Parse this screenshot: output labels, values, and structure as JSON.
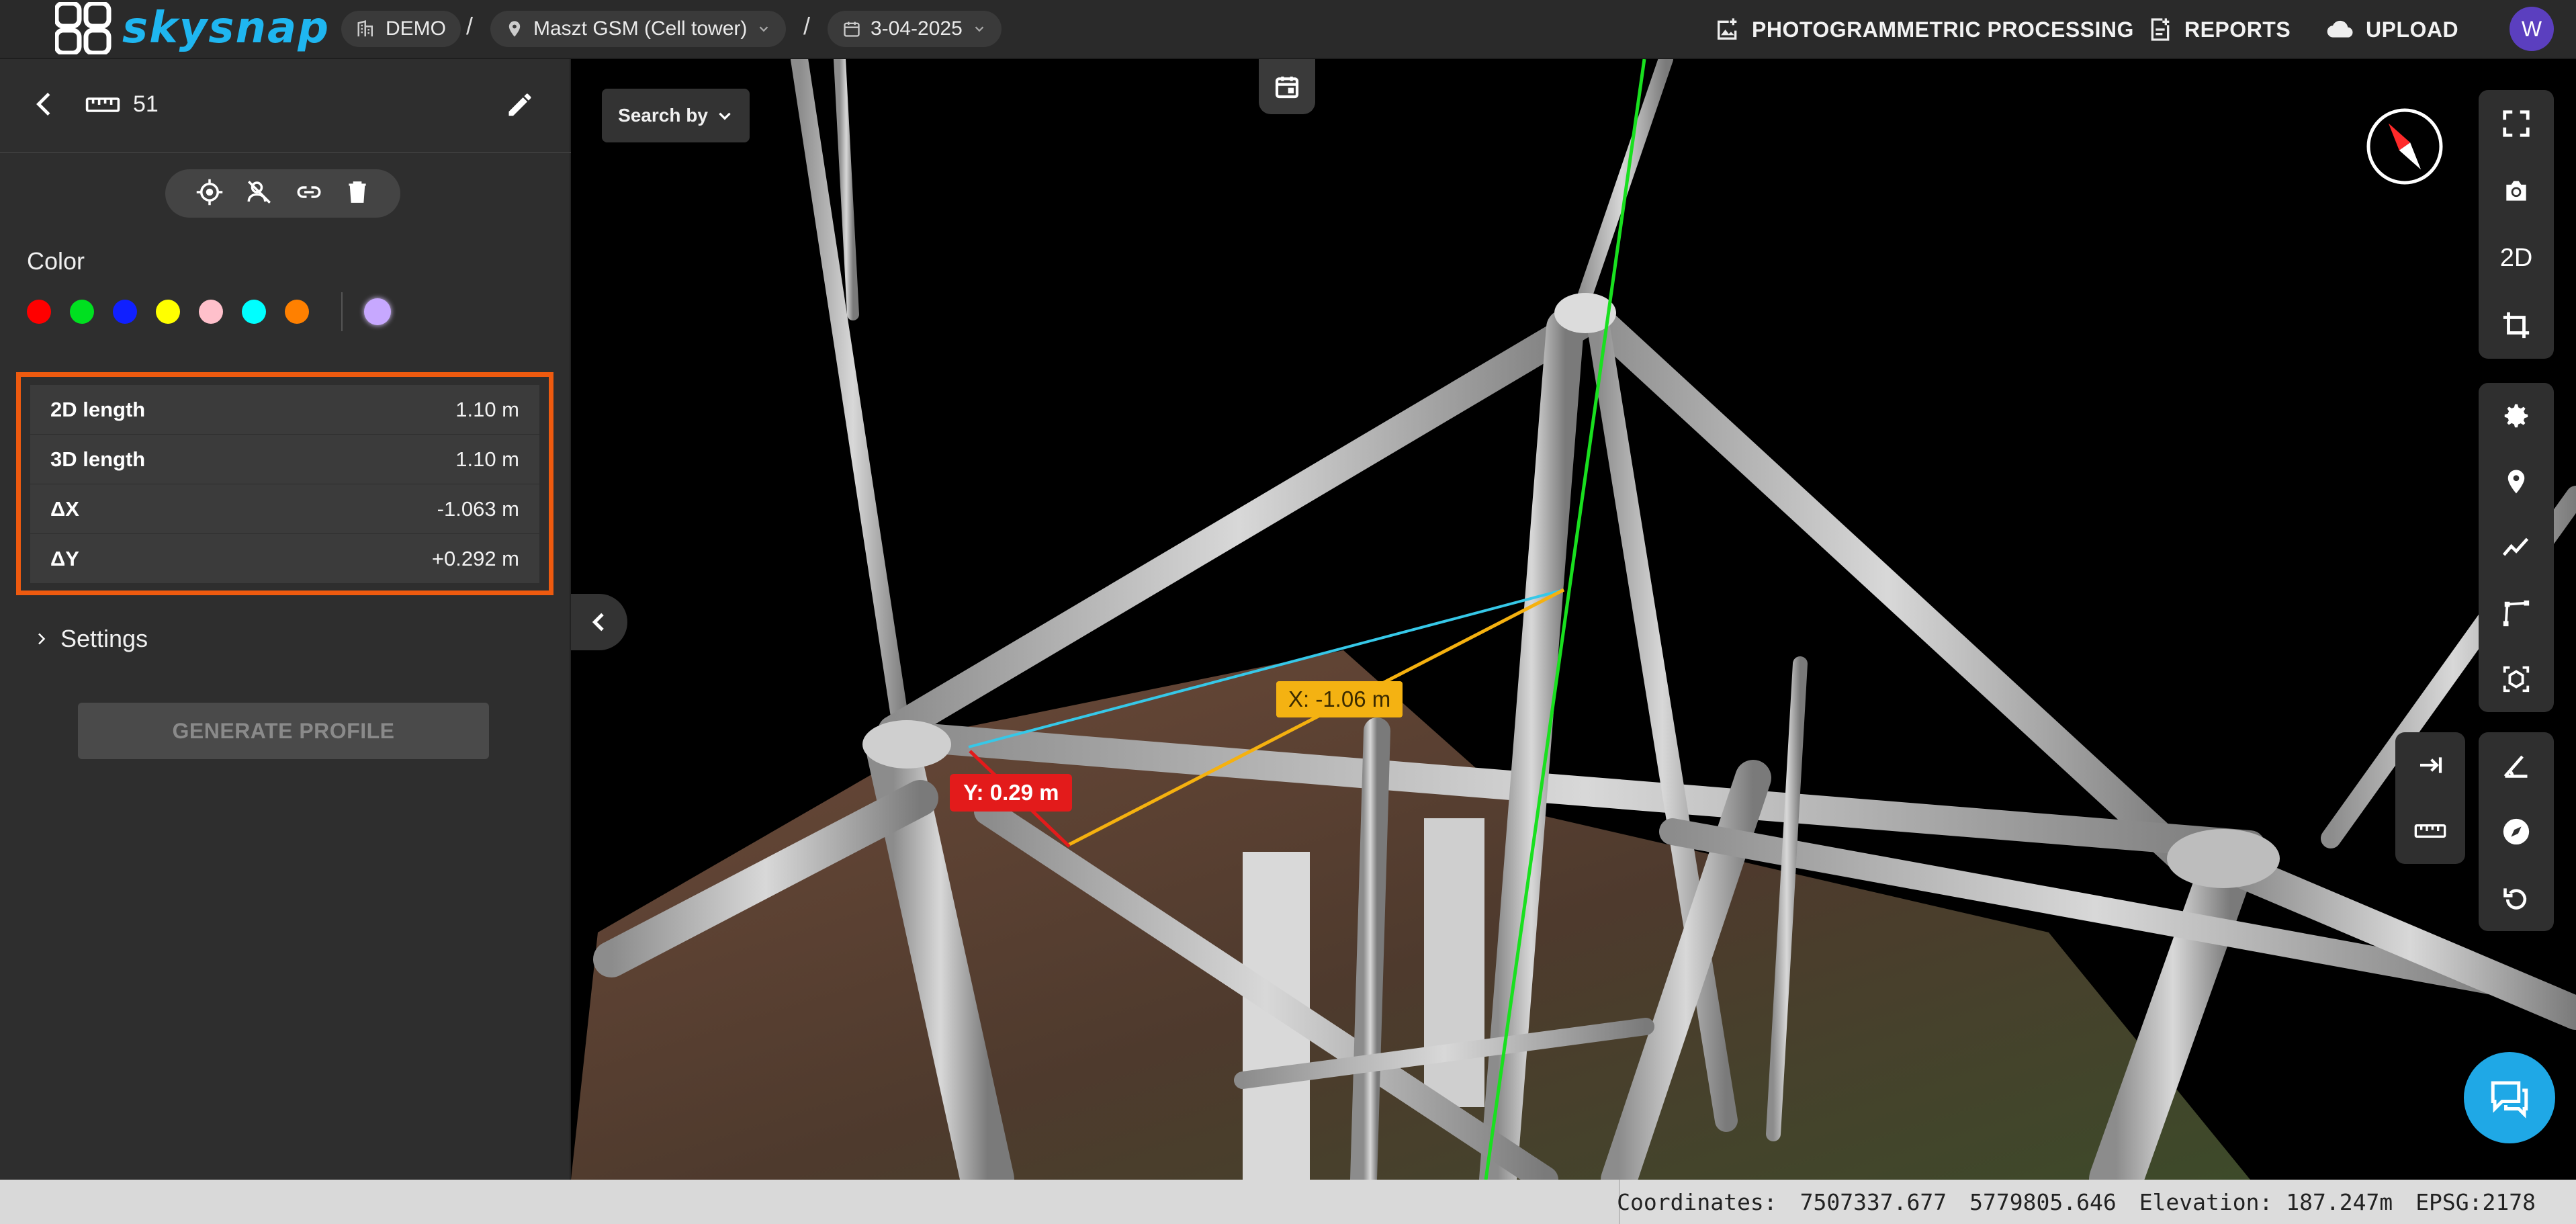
{
  "app": {
    "logo_text": "skysnap"
  },
  "breadcrumb": {
    "project": "DEMO",
    "site": "Maszt GSM (Cell tower)",
    "date": "3-04-2025",
    "separator": "/"
  },
  "header_actions": {
    "photogrammetric": "PHOTOGRAMMETRIC PROCESSING",
    "reports": "REPORTS",
    "upload": "UPLOAD",
    "avatar_initial": "W"
  },
  "panel": {
    "measurement_id": "51",
    "color_title": "Color",
    "colors": [
      "#ff0000",
      "#00e020",
      "#1020ff",
      "#ffff00",
      "#ffc0cb",
      "#00ffff",
      "#ff8000"
    ],
    "custom_color": "#c7a8ff",
    "measurements": [
      {
        "label": "2D length",
        "value": "1.10 m"
      },
      {
        "label": "3D length",
        "value": "1.10 m"
      },
      {
        "label": "ΔX",
        "value": "-1.063 m"
      },
      {
        "label": "ΔY",
        "value": "+0.292 m"
      }
    ],
    "settings_label": "Settings",
    "generate_label": "GENERATE PROFILE",
    "highlight_color": "#ee5a0f"
  },
  "viewer": {
    "search_by": "Search by",
    "x_label": "X: -1.06 m",
    "y_label": "Y: 0.29 m",
    "mode_2d": "2D",
    "x_line_color": "#f5b10f",
    "y_line_color": "#e31b1b",
    "dist_line_color": "#36c8e8",
    "axis_line_color": "#19e01f"
  },
  "status": {
    "coordinates_label": "Coordinates:",
    "coord_x": "7507337.677",
    "coord_y": "5779805.646",
    "elevation": "Elevation: 187.247m",
    "epsg": "EPSG:2178"
  }
}
